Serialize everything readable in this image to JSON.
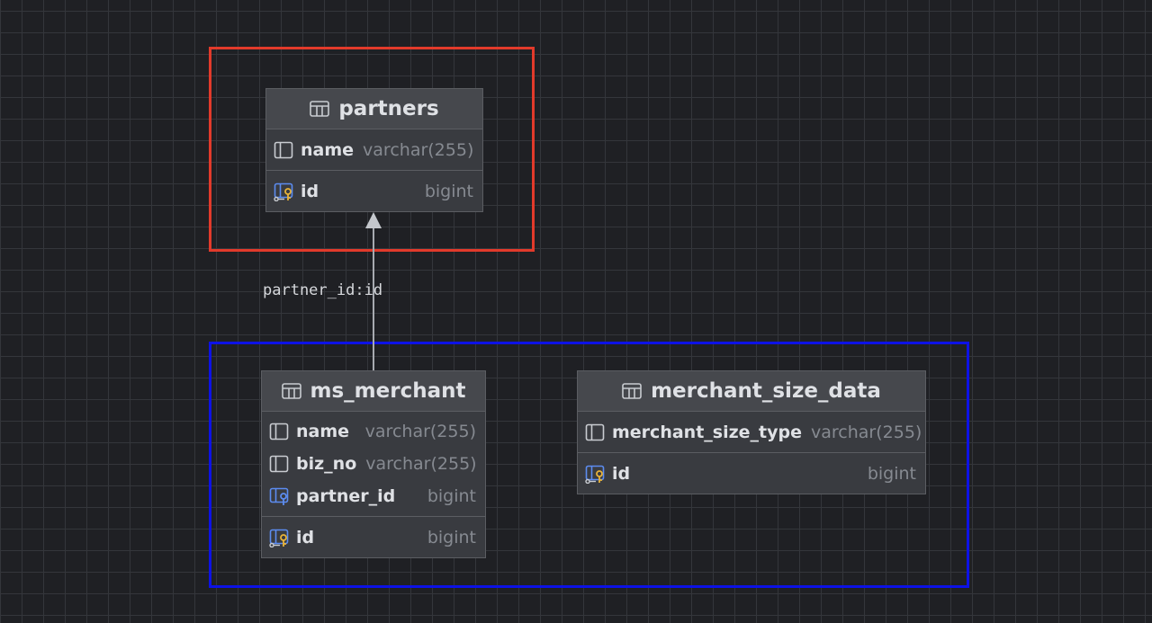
{
  "colors": {
    "canvas_background": "#1f2024",
    "grid_line": "#34363b",
    "table_background": "#393b40",
    "table_header": "#46484d",
    "red_group_border": "#e23a2b",
    "blue_group_border": "#0d12e6",
    "key_icon_gold": "#e8b33a",
    "fk_icon_blue": "#5c8cf0"
  },
  "tables": {
    "partners": {
      "title": "partners",
      "icon": "table-icon",
      "columns": [
        {
          "name": "name",
          "type": "varchar(255)",
          "icon": "column-icon"
        }
      ],
      "keys": [
        {
          "name": "id",
          "type": "bigint",
          "icon": "primary-key-icon"
        }
      ]
    },
    "ms_merchant": {
      "title": "ms_merchant",
      "icon": "table-icon",
      "columns": [
        {
          "name": "name",
          "type": "varchar(255)",
          "icon": "column-icon"
        },
        {
          "name": "biz_no",
          "type": "varchar(255)",
          "icon": "column-icon"
        },
        {
          "name": "partner_id",
          "type": "bigint",
          "icon": "foreign-key-icon"
        }
      ],
      "keys": [
        {
          "name": "id",
          "type": "bigint",
          "icon": "primary-key-icon"
        }
      ]
    },
    "merchant_size_data": {
      "title": "merchant_size_data",
      "icon": "table-icon",
      "columns": [
        {
          "name": "merchant_size_type",
          "type": "varchar(255)",
          "icon": "column-icon"
        }
      ],
      "keys": [
        {
          "name": "id",
          "type": "bigint",
          "icon": "primary-key-icon"
        }
      ]
    }
  },
  "relations": [
    {
      "label": "partner_id:id",
      "from": "ms_merchant",
      "to": "partners"
    }
  ]
}
